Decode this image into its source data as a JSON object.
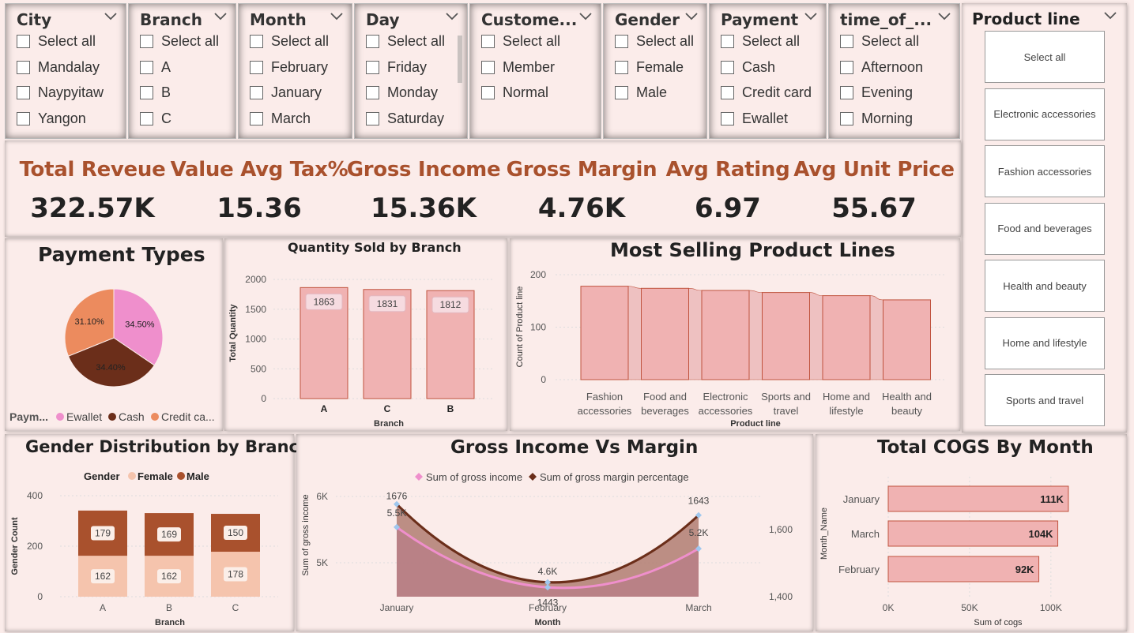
{
  "slicers": [
    {
      "title": "City",
      "options": [
        "Select all",
        "Mandalay",
        "Naypyitaw",
        "Yangon"
      ]
    },
    {
      "title": "Branch",
      "options": [
        "Select all",
        "A",
        "B",
        "C"
      ]
    },
    {
      "title": "Month",
      "options": [
        "Select all",
        "February",
        "January",
        "March"
      ]
    },
    {
      "title": "Day",
      "options": [
        "Select all",
        "Friday",
        "Monday",
        "Saturday"
      ]
    },
    {
      "title": "Custome...",
      "options": [
        "Select all",
        "Member",
        "Normal"
      ]
    },
    {
      "title": "Gender",
      "options": [
        "Select all",
        "Female",
        "Male"
      ]
    },
    {
      "title": "Payment",
      "options": [
        "Select all",
        "Cash",
        "Credit card",
        "Ewallet"
      ]
    },
    {
      "title": "time_of_...",
      "options": [
        "Select all",
        "Afternoon",
        "Evening",
        "Morning"
      ]
    }
  ],
  "product_line_slicer": {
    "title": "Product line",
    "options": [
      "Select all",
      "Electronic accessories",
      "Fashion accessories",
      "Food and beverages",
      "Health and beauty",
      "Home and lifestyle",
      "Sports and travel"
    ]
  },
  "kpis": [
    {
      "label": "Total Reveue",
      "value": "322.57K"
    },
    {
      "label": "Value Avg Tax%",
      "value": "15.36"
    },
    {
      "label": "Gross Income",
      "value": "15.36K"
    },
    {
      "label": "Gross Margin",
      "value": "4.76K"
    },
    {
      "label": "Avg Rating",
      "value": "6.97"
    },
    {
      "label": "Avg Unit Price",
      "value": "55.67"
    }
  ],
  "colors": {
    "accent": "#a9512d",
    "pink": "#ef8fcc",
    "brown": "#6b2e1a",
    "orange": "#ec8b5e",
    "bar": "#f0b2b2",
    "bar_border": "#c0533e",
    "male": "#a9512d",
    "female": "#f5c4ad"
  },
  "chart_data": [
    {
      "type": "pie",
      "title": "Payment Types",
      "legend_title": "Paym...",
      "legend_labels": [
        "Ewallet",
        "Cash",
        "Credit ca..."
      ],
      "categories": [
        "Ewallet",
        "Cash",
        "Credit card"
      ],
      "values": [
        34.5,
        34.4,
        31.1
      ],
      "labels": [
        "34.50%",
        "34.40%",
        "31.10%"
      ]
    },
    {
      "type": "bar",
      "title": "Quantity Sold by Branch",
      "xlabel": "Branch",
      "ylabel": "Total Quantity",
      "categories": [
        "A",
        "C",
        "B"
      ],
      "values": [
        1863,
        1831,
        1812
      ],
      "ylim": [
        0,
        2000
      ],
      "yticks": [
        "0",
        "500",
        "1000",
        "1500",
        "2000"
      ]
    },
    {
      "type": "bar",
      "title": "Most Selling Product Lines",
      "xlabel": "Product line",
      "ylabel": "Count of Product line",
      "categories": [
        [
          "Fashion",
          "accessories"
        ],
        [
          "Food and",
          "beverages"
        ],
        [
          "Electronic",
          "accessories"
        ],
        [
          "Sports and",
          "travel"
        ],
        [
          "Home and",
          "lifestyle"
        ],
        [
          "Health and",
          "beauty"
        ]
      ],
      "values": [
        178,
        174,
        170,
        166,
        160,
        152
      ],
      "ylim": [
        0,
        200
      ],
      "yticks": [
        "0",
        "100",
        "200"
      ]
    },
    {
      "type": "bar",
      "title": "Gender Distribution by Branch",
      "legend_title": "Gender",
      "xlabel": "Branch",
      "ylabel": "Gender Count",
      "categories": [
        "A",
        "B",
        "C"
      ],
      "series": [
        {
          "name": "Female",
          "values": [
            162,
            162,
            178
          ]
        },
        {
          "name": "Male",
          "values": [
            179,
            169,
            150
          ]
        }
      ],
      "ylim": [
        0,
        400
      ],
      "yticks": [
        "0",
        "200",
        "400"
      ]
    },
    {
      "type": "area",
      "title": "Gross Income Vs Margin",
      "xlabel": "Month",
      "ylabel": "Sum of gross income",
      "categories": [
        "January",
        "February",
        "March"
      ],
      "series": [
        {
          "name": "Sum of gross income",
          "values": [
            5537,
            4629,
            5213
          ],
          "labels": [
            "5.5K",
            "4.6K",
            "5.2K"
          ]
        },
        {
          "name": "Sum of gross margin percentage",
          "values": [
            1676,
            1443,
            1643
          ],
          "labels": [
            "1676",
            "1443",
            "1643"
          ]
        }
      ],
      "y_left_ticks": [
        "5K",
        "6K"
      ],
      "y_right_ticks": [
        "1,400",
        "1,600"
      ]
    },
    {
      "type": "bar",
      "title": "Total COGS By Month",
      "xlabel": "Sum of cogs",
      "ylabel": "Month_Name",
      "categories": [
        "January",
        "March",
        "February"
      ],
      "values": [
        110754,
        104243,
        92590
      ],
      "labels": [
        "111K",
        "104K",
        "92K"
      ],
      "xlim": [
        0,
        120000
      ],
      "xticks": [
        "0K",
        "50K",
        "100K"
      ]
    }
  ]
}
